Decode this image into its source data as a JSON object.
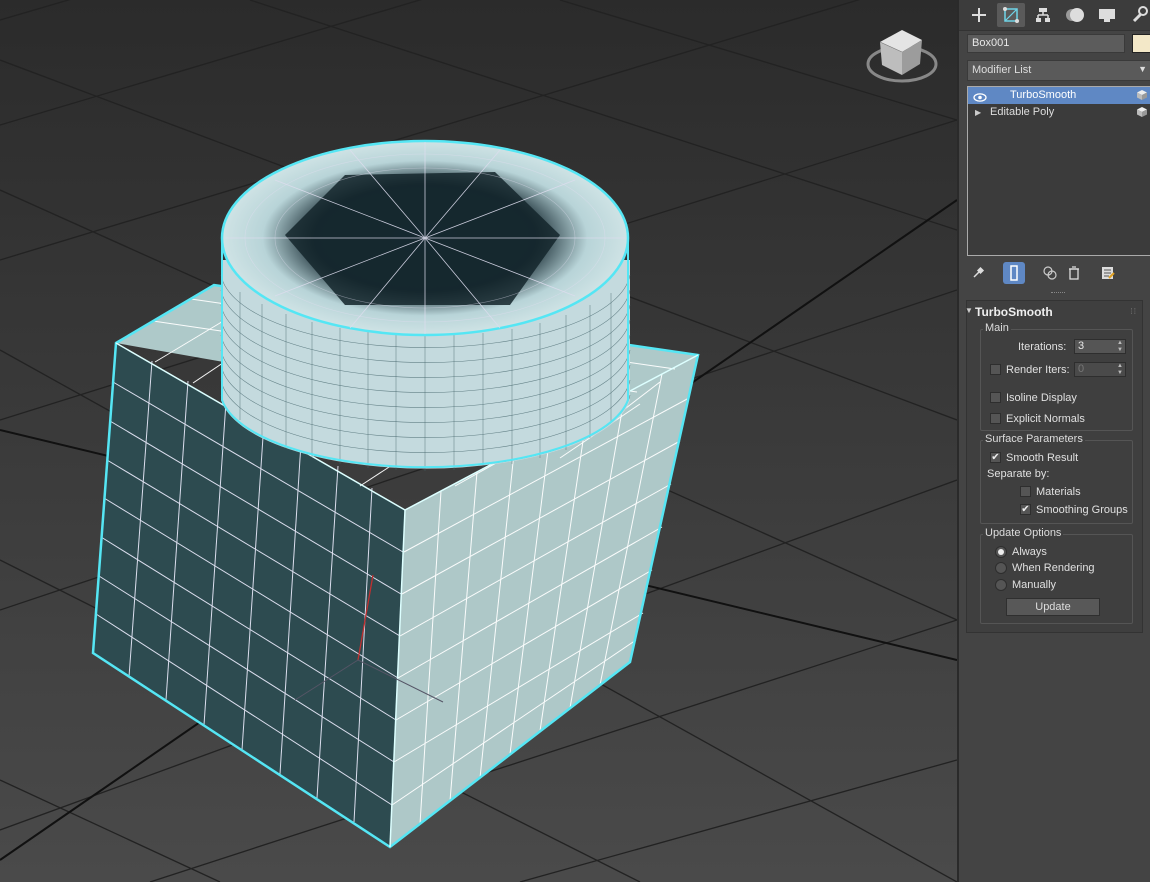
{
  "command_panel": {
    "tabs": [
      {
        "icon": "create-plus-icon"
      },
      {
        "icon": "modify-icon"
      },
      {
        "icon": "hierarchy-icon"
      },
      {
        "icon": "motion-icon"
      },
      {
        "icon": "display-icon"
      },
      {
        "icon": "utilities-wrench-icon"
      }
    ],
    "object_name": "Box001",
    "object_color": "#f3e8c8",
    "modifier_list_label": "Modifier List",
    "stack": [
      {
        "label": "TurboSmooth",
        "selected": true
      },
      {
        "label": "Editable Poly",
        "selected": false
      }
    ]
  },
  "turbosmooth": {
    "title": "TurboSmooth",
    "main": {
      "group_label": "Main",
      "iterations_label": "Iterations:",
      "iterations_value": "3",
      "render_iters_label": "Render Iters:",
      "render_iters_value": "0",
      "isoline_label": "Isoline Display",
      "explicit_normals_label": "Explicit Normals"
    },
    "surface": {
      "group_label": "Surface Parameters",
      "smooth_result_label": "Smooth Result",
      "separate_by_label": "Separate by:",
      "materials_label": "Materials",
      "smoothing_groups_label": "Smoothing Groups"
    },
    "update": {
      "group_label": "Update Options",
      "always_label": "Always",
      "when_rendering_label": "When Rendering",
      "manually_label": "Manually",
      "update_button": "Update"
    }
  },
  "colors": {
    "viewport_bg": "#3a3a3a",
    "selection_highlight": "#55e6f4",
    "stack_selected": "#5f88c4"
  }
}
